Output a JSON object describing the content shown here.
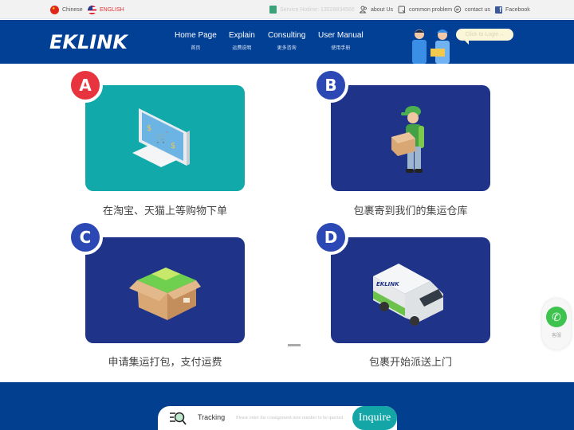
{
  "topbar": {
    "lang_cn": "Chinese",
    "lang_en": "ENGLISH",
    "hotline": "Service Hotline: 13028834566",
    "links": [
      {
        "label": "about Us",
        "icon": "users-icon"
      },
      {
        "label": "common problem",
        "icon": "question-doc-icon"
      },
      {
        "label": "contact us",
        "icon": "chat-icon"
      },
      {
        "label": "Facebook",
        "icon": "facebook-icon"
      }
    ]
  },
  "header": {
    "logo": "EKLINK",
    "nav": [
      {
        "en": "Home Page",
        "cn": "首页"
      },
      {
        "en": "Explain",
        "cn": "运费说明"
      },
      {
        "en": "Consulting",
        "cn": "更多咨询"
      },
      {
        "en": "User Manual",
        "cn": "使用手册"
      }
    ],
    "login": "Click to Login→"
  },
  "steps": [
    {
      "letter": "A",
      "caption": "在淘宝、天猫上等购物下单",
      "badge_color": "#e8343f",
      "card_color": "#11a9aa",
      "illustration": "computer-shopping-icon"
    },
    {
      "letter": "B",
      "caption": "包裹寄到我们的集运仓库",
      "badge_color": "#2b48b4",
      "card_color": "#1f3489",
      "illustration": "delivery-man-icon"
    },
    {
      "letter": "C",
      "caption": "申请集运打包，支付运费",
      "badge_color": "#2b48b4",
      "card_color": "#1f3489",
      "illustration": "open-box-icon"
    },
    {
      "letter": "D",
      "caption": "包裹开始派送上门",
      "badge_color": "#2b48b4",
      "card_color": "#1f3489",
      "illustration": "delivery-van-icon"
    }
  ],
  "whatsapp": {
    "label": "客服"
  },
  "tracking": {
    "label": "Tracking",
    "placeholder": "Please enter the consignment note number to be queried",
    "button": "Inquire"
  }
}
